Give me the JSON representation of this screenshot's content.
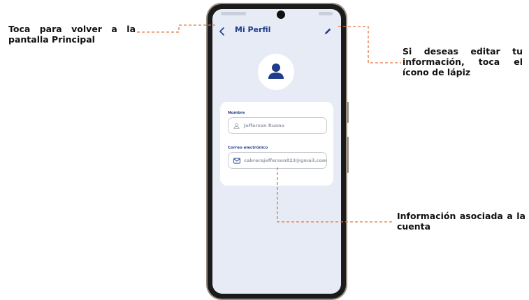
{
  "annotations": {
    "back": "Toca para volver a la pantalla Principal",
    "edit": "Si deseas editar tu información, toca el ícono de lápiz",
    "info": "Información asociada a la cuenta"
  },
  "app": {
    "title": "Mi Perfil",
    "fields": [
      {
        "label": "Nombre",
        "value": "Jefferson Ruano",
        "icon": "user-icon"
      },
      {
        "label": "Correo electrónico",
        "value": "cabrerajefferson823@gmail.com",
        "icon": "mail-icon"
      }
    ]
  },
  "colors": {
    "accent": "#1f3d8a",
    "leader_line": "#e8733a",
    "screen_bg": "#e6ebf5",
    "field_text": "#9ea3ad"
  }
}
